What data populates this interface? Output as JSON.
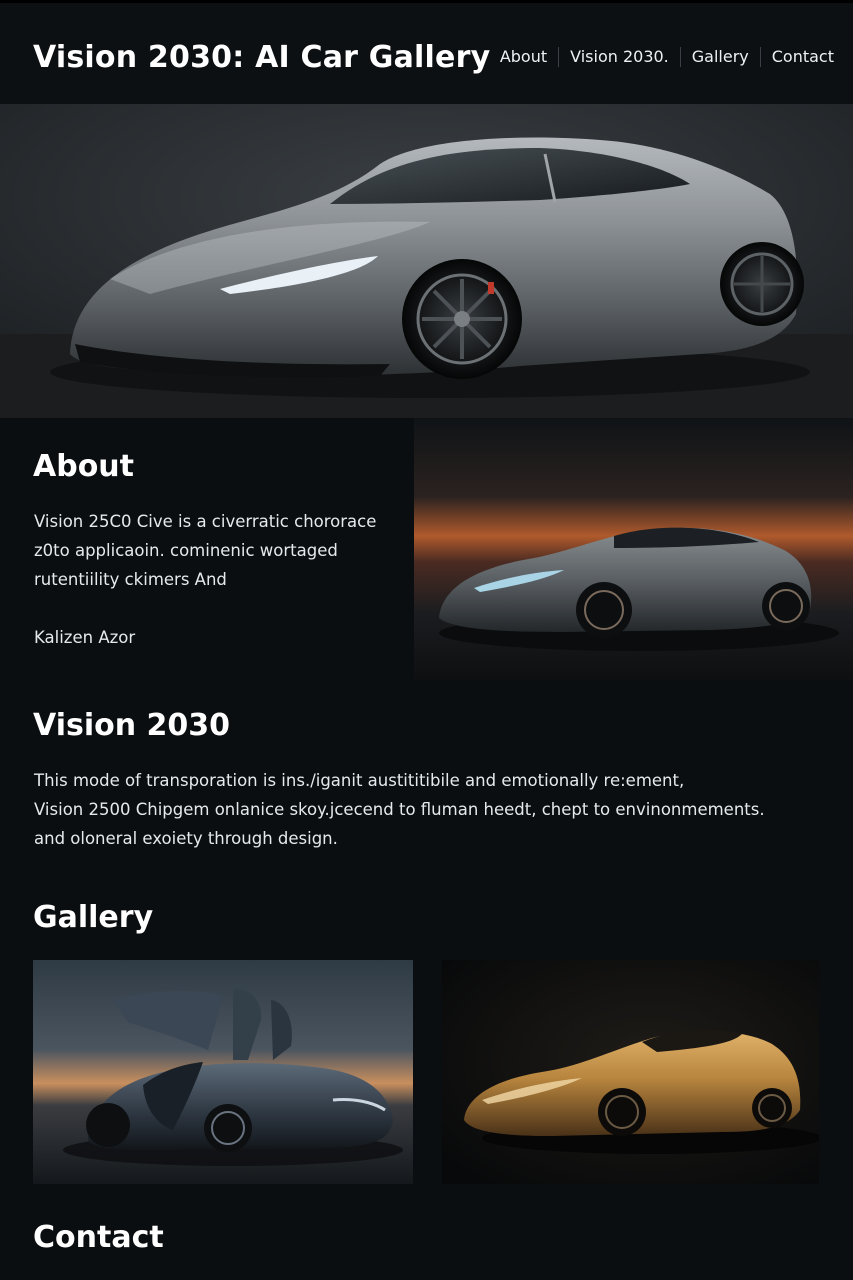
{
  "header": {
    "title": "Vision 2030: AI Car Gallery",
    "nav": [
      "About",
      "Vision 2030.",
      "Gallery",
      "Contact"
    ]
  },
  "about": {
    "heading": "About",
    "lines": [
      "Vision 25C0 Cive is a civerratic chororace",
      "z0to applicaoin. cominenic wortaged",
      "rutentiility ckimers And"
    ],
    "signature": "Kalizen Azor"
  },
  "vision": {
    "heading": "Vision 2030",
    "lines": [
      "This mode of transporation is ins./iganit austititibile and emotionally re:ement,",
      "Vision 2500 Chipgem onlanice skoy.jcecend to fluman heedt, chept to envinonmements.",
      "and oloneral exoiety through design."
    ]
  },
  "gallery": {
    "heading": "Gallery"
  },
  "contact": {
    "heading": "Contact"
  },
  "colors": {
    "background": "#0b0e11",
    "header": "#0d1013",
    "text": "#ffffff",
    "sunset_accent": "#c8622b",
    "gold_car": "#b8853e"
  }
}
